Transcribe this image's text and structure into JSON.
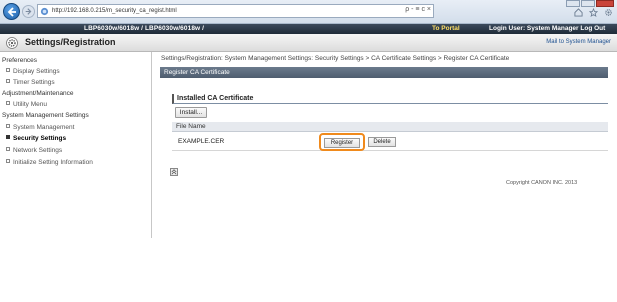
{
  "browser": {
    "url": "http://192.168.0.215/m_security_ca_regist.html",
    "address_tools": "ρ - ≡ c ×",
    "home_icon": "home-icon",
    "favorites_icon": "star-icon",
    "tools_icon": "gear-icon"
  },
  "topbar": {
    "device": "LBP6030w/6018w / LBP6030w/6018w /",
    "portal": "To Portal",
    "login": "Login User: System Manager Log Out"
  },
  "titlebar": {
    "title": "Settings/Registration",
    "mail": "Mail to System Manager"
  },
  "leftnav": {
    "items": [
      {
        "label": "Preferences",
        "kind": "head"
      },
      {
        "label": "Display Settings",
        "kind": "sub"
      },
      {
        "label": "Timer Settings",
        "kind": "sub"
      },
      {
        "label": "Adjustment/Maintenance",
        "kind": "head"
      },
      {
        "label": "Utility Menu",
        "kind": "sub"
      },
      {
        "label": "System Management Settings",
        "kind": "head"
      },
      {
        "label": "System Management",
        "kind": "sub"
      },
      {
        "label": "Security Settings",
        "kind": "sub",
        "active": true
      },
      {
        "label": "Network Settings",
        "kind": "sub"
      },
      {
        "label": "Initialize Setting Information",
        "kind": "sub"
      }
    ]
  },
  "main": {
    "breadcrumb": "Settings/Registration: System Management Settings: Security Settings > CA Certificate Settings > Register CA Certificate",
    "page_heading": "Register CA Certificate",
    "section_title": "Installed CA Certificate",
    "install_label": "Install...",
    "column_header": "File Name",
    "rows": [
      {
        "file_name": "EXAMPLE.CER",
        "register_label": "Register",
        "delete_label": "Delete"
      }
    ],
    "copyright": "Copyright CANON INC. 2013"
  },
  "colors": {
    "highlight": "#f08a1c",
    "header_band": "#1f2b38",
    "page_heading_bg": "#5a697b"
  }
}
